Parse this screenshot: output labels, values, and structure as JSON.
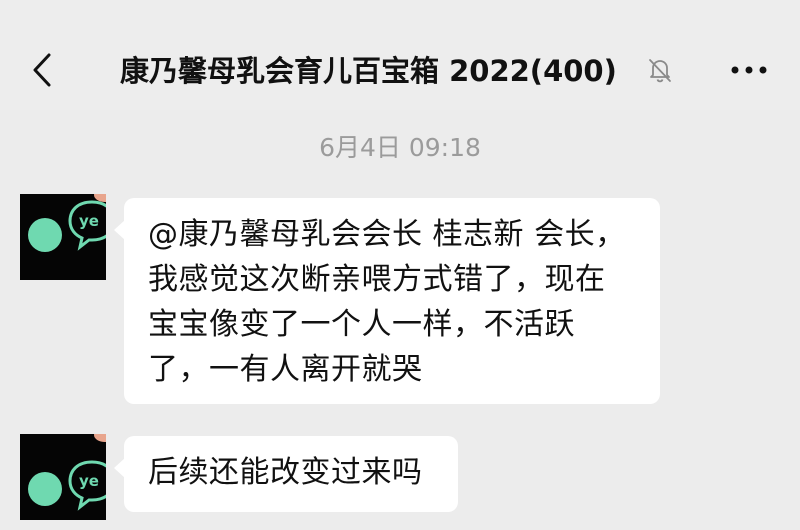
{
  "header": {
    "title": "康乃馨母乳会育儿百宝箱 2022(400)",
    "back_icon": "chevron-left-icon",
    "mute_icon": "bell-muted-icon",
    "more_icon": "more-horizontal-icon"
  },
  "timestamp": "6月4日 09:18",
  "messages": [
    {
      "lines": [
        "@康乃馨母乳会会长 桂志新 会长，",
        "我感觉这次断亲喂方式错了，现在",
        "宝宝像变了一个人一样，不活跃",
        "了，一有人离开就哭"
      ]
    },
    {
      "lines": [
        "后续还能改变过来吗"
      ]
    }
  ],
  "colors": {
    "background": "#ececec",
    "bubble": "#ffffff",
    "avatar_accent": "#6fd9b0"
  }
}
